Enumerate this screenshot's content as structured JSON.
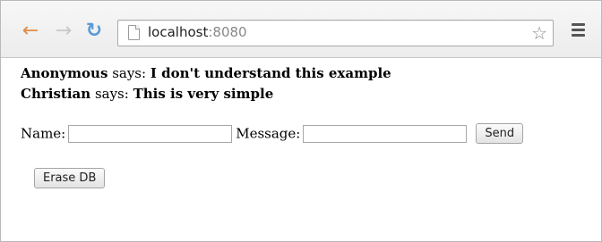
{
  "browser": {
    "url_host": "localhost",
    "url_port": ":8080"
  },
  "messages": [
    {
      "author": "Anonymous",
      "verb": "says:",
      "text": "I don't understand this example"
    },
    {
      "author": "Christian",
      "verb": "says:",
      "text": "This is very simple"
    }
  ],
  "form": {
    "name_label": "Name:",
    "name_value": "",
    "message_label": "Message:",
    "message_value": "",
    "send_label": "Send"
  },
  "erase_label": "Erase DB",
  "colors": {
    "back_arrow": "#e38b45",
    "reload": "#5a9ad6"
  }
}
